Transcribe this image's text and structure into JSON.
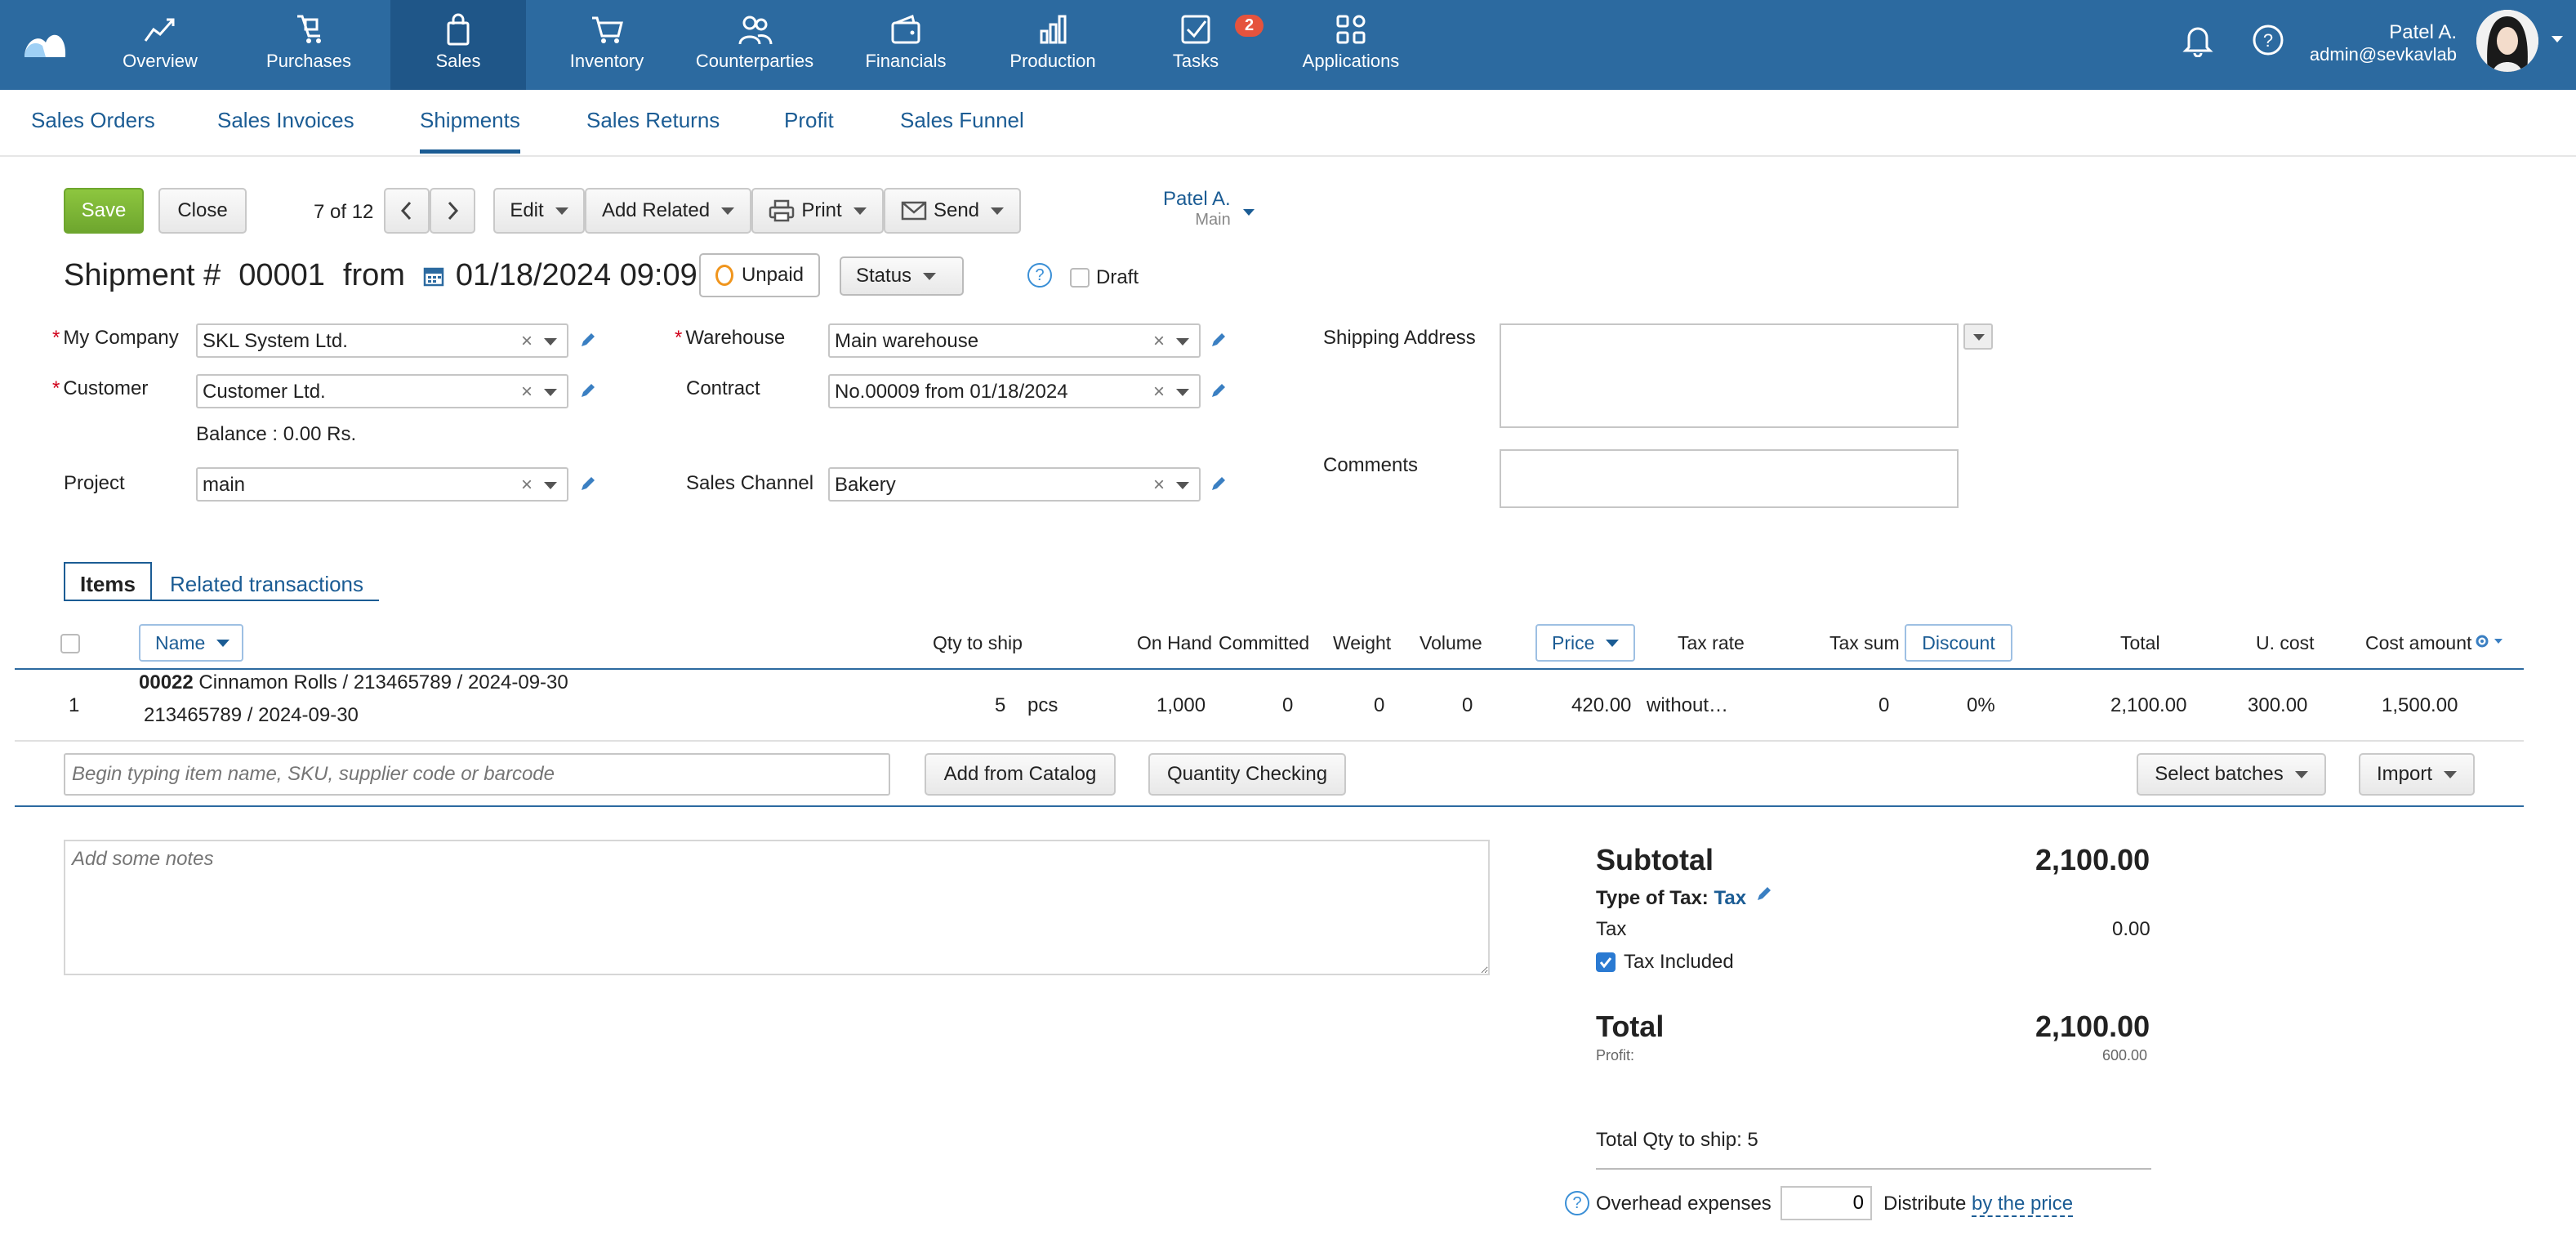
{
  "nav": {
    "items": [
      {
        "label": "Overview",
        "icon": "chart-line-icon"
      },
      {
        "label": "Purchases",
        "icon": "cart-dolly-icon"
      },
      {
        "label": "Sales",
        "icon": "shopping-bag-icon"
      },
      {
        "label": "Inventory",
        "icon": "cart-icon"
      },
      {
        "label": "Counterparties",
        "icon": "people-icon"
      },
      {
        "label": "Financials",
        "icon": "wallet-icon"
      },
      {
        "label": "Production",
        "icon": "bar-chart-icon"
      },
      {
        "label": "Tasks",
        "icon": "checkbox-icon"
      },
      {
        "label": "Applications",
        "icon": "apps-grid-icon"
      }
    ],
    "tasks_badge": "2",
    "active": "Sales"
  },
  "user": {
    "name": "Patel A.",
    "email": "admin@sevkavlab"
  },
  "subnav": {
    "items": [
      "Sales Orders",
      "Sales Invoices",
      "Shipments",
      "Sales Returns",
      "Profit",
      "Sales Funnel"
    ],
    "active": "Shipments"
  },
  "toolbar": {
    "save": "Save",
    "close": "Close",
    "pager": "7 of 12",
    "edit": "Edit",
    "add_related": "Add Related",
    "print": "Print",
    "send": "Send",
    "owner_name": "Patel A.",
    "owner_sub": "Main"
  },
  "doc": {
    "title_prefix": "Shipment #",
    "number": "00001",
    "from": "from",
    "date": "01/18/2024 09:09",
    "payment_status": "Unpaid",
    "status_label": "Status",
    "help": "?",
    "draft": "Draft"
  },
  "form": {
    "my_company_label": "My Company",
    "my_company": "SKL System Ltd.",
    "customer_label": "Customer",
    "customer": "Customer Ltd.",
    "balance": "Balance : 0.00 Rs.",
    "project_label": "Project",
    "project": "main",
    "warehouse_label": "Warehouse",
    "warehouse": "Main warehouse",
    "contract_label": "Contract",
    "contract": "No.00009 from 01/18/2024",
    "sales_channel_label": "Sales Channel",
    "sales_channel": "Bakery",
    "shipping_address_label": "Shipping Address",
    "comments_label": "Comments",
    "clear": "×"
  },
  "tabs": {
    "items": "Items",
    "related": "Related transactions"
  },
  "table": {
    "headers": {
      "name": "Name",
      "qty_to_ship": "Qty to ship",
      "on_hand": "On Hand",
      "committed": "Committed",
      "weight": "Weight",
      "volume": "Volume",
      "price": "Price",
      "tax_rate": "Tax rate",
      "tax_sum": "Tax sum",
      "discount": "Discount",
      "total": "Total",
      "u_cost": "U. cost",
      "cost_amount": "Cost amount"
    },
    "rows": [
      {
        "index": "1",
        "code": "00022",
        "name": " Cinnamon Rolls / 213465789 / 2024-09-30",
        "batch": "213465789 / 2024-09-30",
        "qty": "5",
        "unit": "pcs",
        "on_hand": "1,000",
        "committed": "0",
        "weight": "0",
        "volume": "0",
        "price": "420.00",
        "tax_rate": "without…",
        "tax_sum": "0",
        "discount": "0%",
        "total": "2,100.00",
        "u_cost": "300.00",
        "cost_amount": "1,500.00"
      }
    ],
    "search_placeholder": "Begin typing item name, SKU, supplier code or barcode",
    "add_from_catalog": "Add from Catalog",
    "quantity_checking": "Quantity Checking",
    "select_batches": "Select batches",
    "import": "Import"
  },
  "notes": {
    "placeholder": "Add some notes"
  },
  "summary": {
    "subtotal_label": "Subtotal",
    "subtotal": "2,100.00",
    "type_of_tax_label": "Type of Tax:",
    "type_of_tax": "Tax",
    "tax_label": "Tax",
    "tax": "0.00",
    "tax_included": "Tax Included",
    "total_label": "Total",
    "total": "2,100.00",
    "profit_label": "Profit:",
    "profit": "600.00",
    "total_qty": "Total Qty to ship: 5",
    "overhead_label": "Overhead expenses",
    "overhead_value": "0",
    "distribute": "Distribute",
    "distribute_by": "by the price"
  },
  "colors": {
    "topbar": "#2c6aa0",
    "accent": "#1b5c94",
    "save": "#7ab53a",
    "unpaid": "#f0951d",
    "badge": "#e5533d"
  }
}
